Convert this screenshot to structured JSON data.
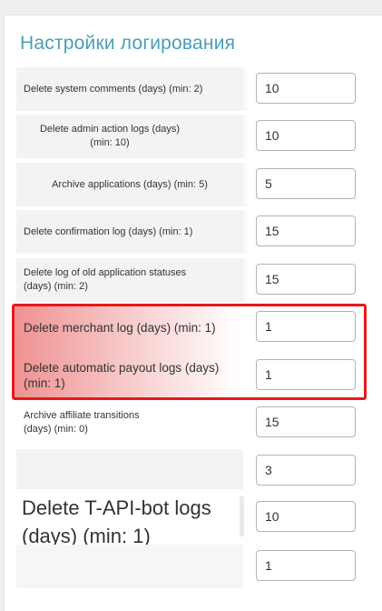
{
  "section": {
    "title": "Настройки логирования"
  },
  "rows": [
    {
      "label": "Delete system comments (days) (min: 2)",
      "value": "10"
    },
    {
      "label": "Delete admin action logs (days)\n(min: 10)",
      "value": "10"
    },
    {
      "label": "Archive applications (days) (min: 5)",
      "value": "5"
    },
    {
      "label": "Delete confirmation log (days) (min: 1)",
      "value": "15"
    },
    {
      "label": "Delete log of old application statuses\n(days) (min: 2)",
      "value": "15"
    },
    {
      "label": "Delete merchant log (days) (min: 1)",
      "value": "1"
    },
    {
      "label": "Delete automatic payout logs (days)\n(min: 1)",
      "value": "1"
    },
    {
      "label": "Archive affiliate transitions\n(days) (min: 0)",
      "value": "15"
    },
    {
      "label": "",
      "value": "3"
    },
    {
      "label": "Delete T-API-bot logs\n(days) (min: 1)",
      "value": "10"
    },
    {
      "label": "",
      "value": "1"
    }
  ],
  "colors": {
    "title": "#4a9fb5",
    "highlight_border": "#e8181b"
  }
}
